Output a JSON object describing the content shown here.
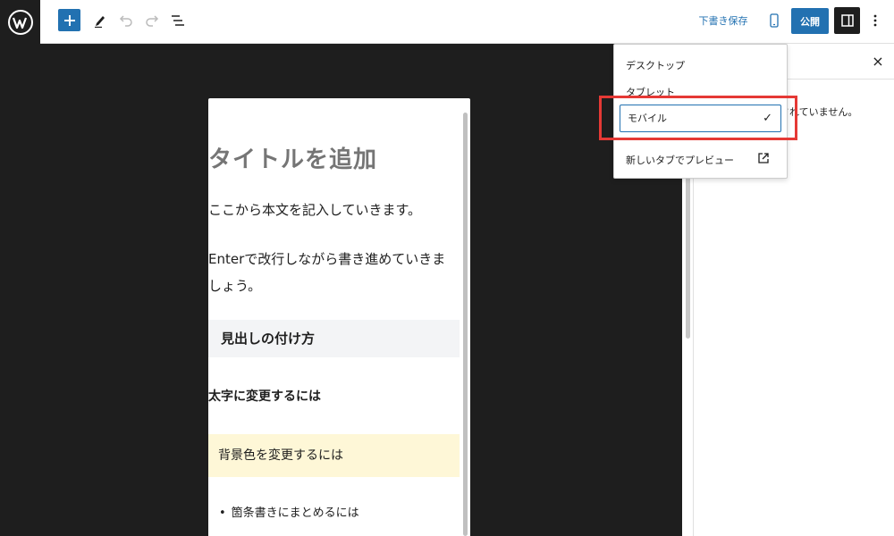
{
  "toolbar": {
    "add_label": "+",
    "save_draft": "下書き保存",
    "publish": "公開"
  },
  "editor": {
    "title_placeholder": "タイトルを追加",
    "paragraph1": "ここから本文を記入していきます。",
    "paragraph2": "Enterで改行しながら書き進めていきましょう。",
    "heading": "見出しの付け方",
    "bold_text": "太字に変更するには",
    "bg_text": "背景色を変更するには",
    "list_item": "箇条書きにまとめるには"
  },
  "preview_menu": {
    "desktop": "デスクトップ",
    "tablet": "タブレット",
    "mobile": "モバイル",
    "mobile_check": "✓",
    "new_tab": "新しいタブでプレビュー"
  },
  "sidebar": {
    "close": "×",
    "partial_text": "されていません。"
  },
  "colors": {
    "accent": "#2271b1",
    "highlight": "#e53935",
    "canvas": "#1e1e1e"
  },
  "icons": {
    "logo": "wordpress-logo",
    "add": "plus-icon",
    "tools": "pencil-icon",
    "undo": "undo-icon",
    "redo": "redo-icon",
    "outline": "list-view-icon",
    "device": "mobile-device-icon",
    "settings": "sidebar-toggle-icon",
    "more": "more-vertical-icon",
    "external": "external-link-icon"
  }
}
